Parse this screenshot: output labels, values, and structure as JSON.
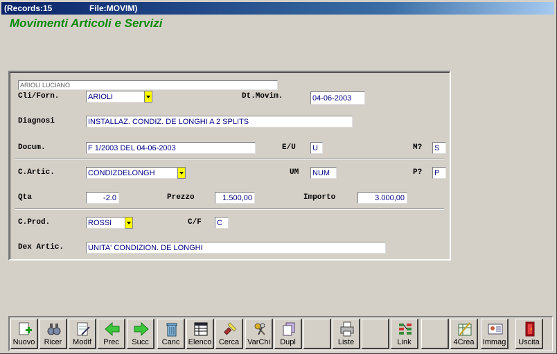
{
  "window": {
    "records": "(Records:15",
    "file": "File:MOVIM)"
  },
  "heading": "Movimenti Articoli e Servizi",
  "form": {
    "customer_name": "ARIOLI LUCIANO",
    "cli_forn_label": "Cli/Forn.",
    "cli_forn_value": "ARIOLI",
    "dt_movim_label": "Dt.Movim.",
    "dt_movim_value": "04-06-2003",
    "diagnosi_label": "Diagnosi",
    "diagnosi_value": "INSTALLAZ. CONDIZ. DE LONGHI A 2 SPLITS",
    "docum_label": "Docum.",
    "docum_value": "F 1/2003 DEL 04-06-2003",
    "eu_label": "E/U",
    "eu_value": "U",
    "m_label": "M?",
    "m_value": "S",
    "c_artic_label": "C.Artic.",
    "c_artic_value": "CONDIZDELONGH",
    "um_label": "UM",
    "um_value": "NUM",
    "p_label": "P?",
    "p_value": "P",
    "qta_label": "Qta",
    "qta_value": "-2.0",
    "prezzo_label": "Prezzo",
    "prezzo_value": "1.500,00",
    "importo_label": "Importo",
    "importo_value": "3.000,00",
    "c_prod_label": "C.Prod.",
    "c_prod_value": "ROSSI",
    "cf_label": "C/F",
    "cf_value": "C",
    "dex_artic_label": "Dex Artic.",
    "dex_artic_value": "UNITA' CONDIZION. DE LONGHI"
  },
  "toolbar": {
    "nuovo": "Nuovo",
    "ricer": "Ricer",
    "modif": "Modif",
    "prec": "Prec",
    "succ": "Succ",
    "canc": "Canc",
    "elenco": "Elenco",
    "cerca": "Cerca",
    "varchi": "VarChi",
    "dupl": "Dupl",
    "liste": "Liste",
    "link": "Link",
    "crea4": "4Crea",
    "immag": "Immag",
    "uscita": "Uscita"
  },
  "icons": {
    "nuovo": "new-document-plus-icon",
    "ricer": "binoculars-icon",
    "modif": "edit-document-icon",
    "prec": "green-arrow-left-icon",
    "succ": "green-arrow-right-icon",
    "canc": "trash-can-icon",
    "elenco": "table-list-icon",
    "cerca": "flashlight-search-icon",
    "varchi": "keys-icon",
    "dupl": "duplicate-icon",
    "liste": "printer-icon",
    "link": "link-blocks-icon",
    "crea4": "create-wizard-icon",
    "immag": "id-card-icon",
    "uscita": "exit-door-icon"
  },
  "colors": {
    "heading": "#0a8a0a",
    "field_text": "#000080",
    "dropdown": "#ffff00",
    "titlebar": "#0a246a"
  }
}
